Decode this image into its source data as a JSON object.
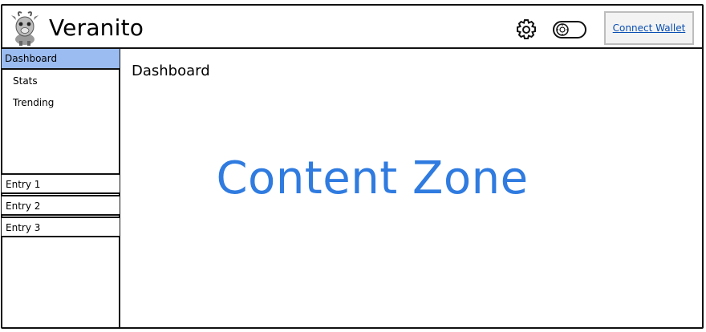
{
  "header": {
    "app_title": "Veranito",
    "logo_icon": "goat-mascot-icon",
    "settings_icon": "gear-icon",
    "theme_toggle_icon": "toggle-switch-icon",
    "connect_label": "Connect Wallet"
  },
  "sidebar": {
    "items": [
      {
        "label": "Dashboard",
        "active": true
      },
      {
        "label": "Stats",
        "active": false
      },
      {
        "label": "Trending",
        "active": false
      }
    ],
    "entries": [
      {
        "label": "Entry 1"
      },
      {
        "label": "Entry 2"
      },
      {
        "label": "Entry 3"
      }
    ]
  },
  "main": {
    "title": "Dashboard",
    "placeholder": "Content Zone"
  },
  "colors": {
    "active_nav_bg": "#9bbcf0",
    "placeholder_text": "#2f7be0",
    "link": "#0a4fb3",
    "border": "#111111"
  }
}
